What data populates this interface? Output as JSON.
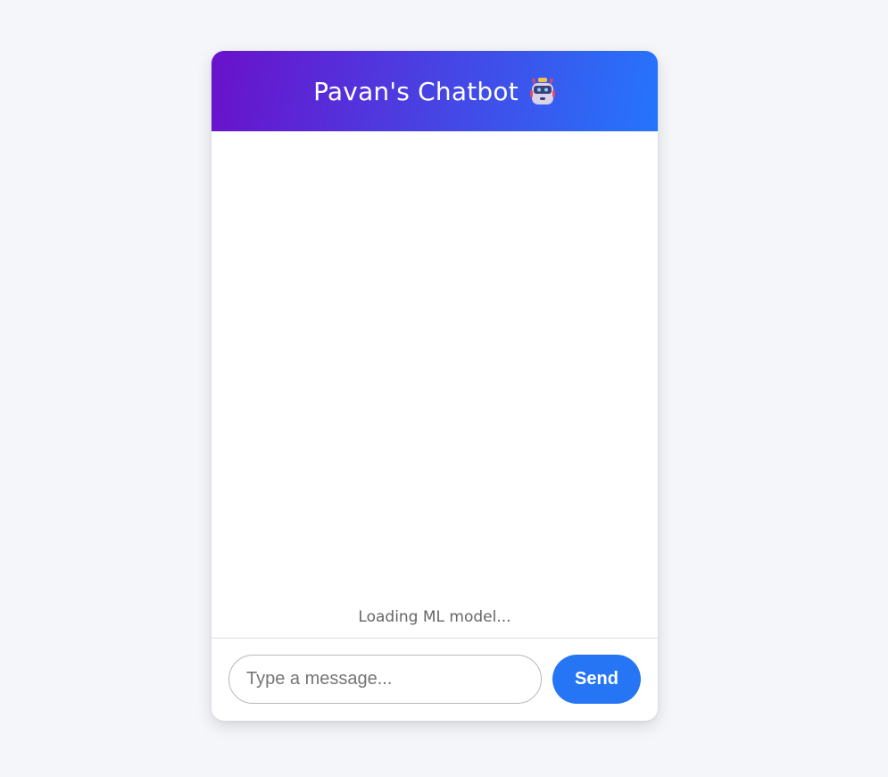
{
  "header": {
    "title": "Pavan's Chatbot",
    "icon": "robot-icon",
    "gradient_start": "#6a11cb",
    "gradient_end": "#2575fc"
  },
  "chat": {
    "messages": [],
    "status": "Loading ML model..."
  },
  "composer": {
    "placeholder": "Type a message...",
    "value": "",
    "send_label": "Send",
    "send_color": "#2575f5"
  },
  "colors": {
    "page_background": "#f4f6fa",
    "card_background": "#ffffff"
  }
}
